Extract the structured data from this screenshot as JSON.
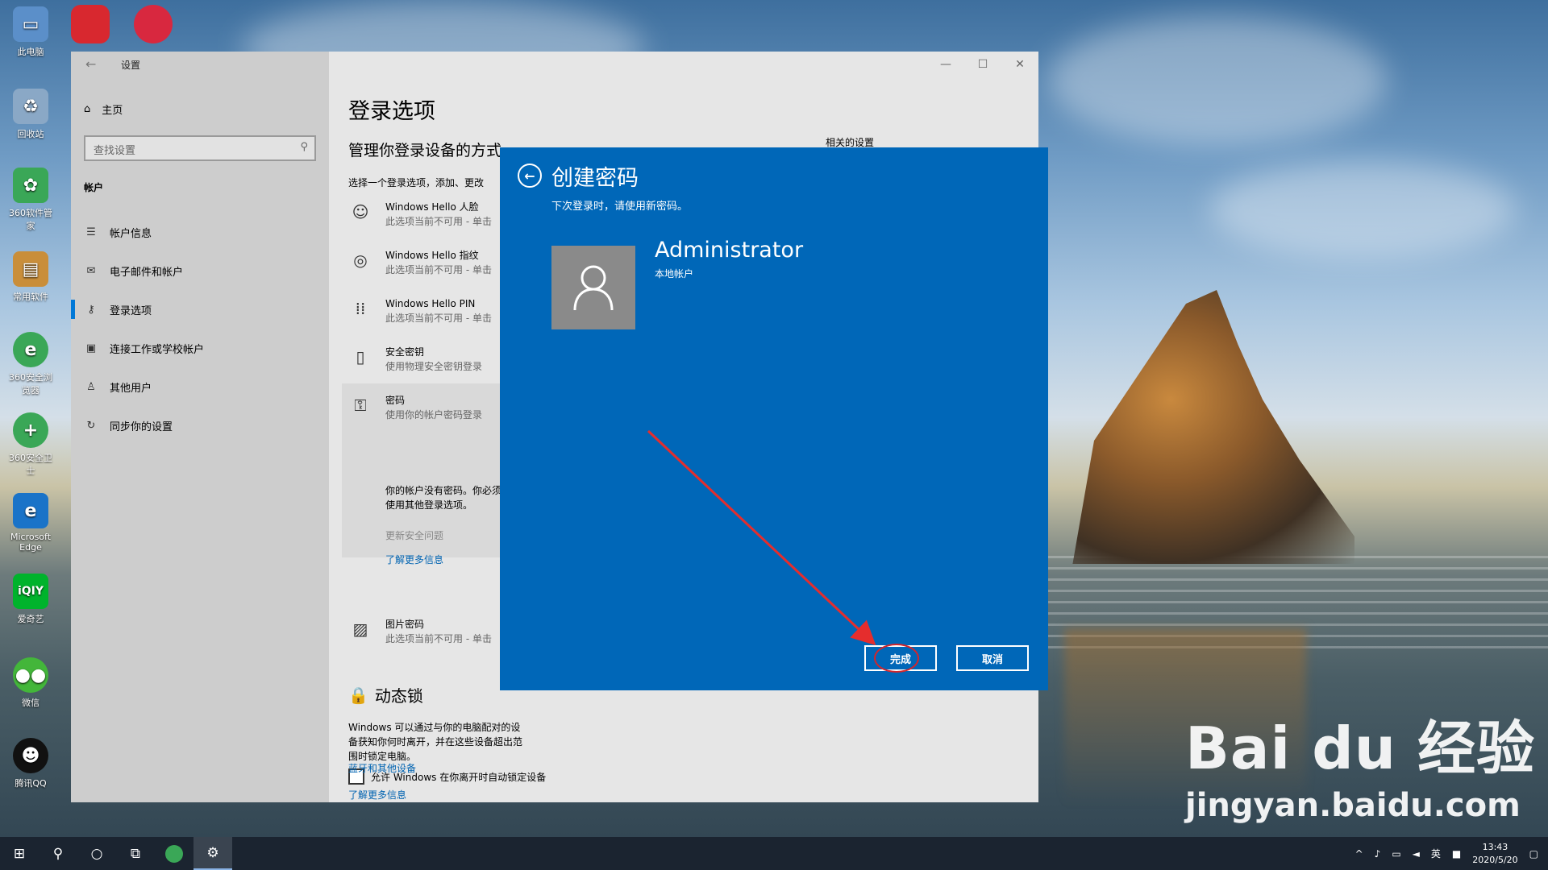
{
  "desktop": {
    "icons": [
      {
        "label": "此电脑",
        "icon": "computer-icon",
        "color": "#5b8fc9"
      },
      {
        "label": "回收站",
        "icon": "recycle-bin-icon",
        "color": "#8aa8c6"
      },
      {
        "label": "360软件管家",
        "icon": "360-manager-icon",
        "color": "#3aa757"
      },
      {
        "label": "常用软件",
        "icon": "folder-icon",
        "color": "#c98e3a"
      },
      {
        "label": "360安全浏览器",
        "icon": "360-browser-icon",
        "color": "#3aa757"
      },
      {
        "label": "360安全卫士",
        "icon": "360-guard-icon",
        "color": "#3aa757"
      },
      {
        "label": "Microsoft Edge",
        "icon": "edge-icon",
        "color": "#1a73c8"
      },
      {
        "label": "爱奇艺",
        "icon": "iqiyi-icon",
        "color": "#00b32c"
      },
      {
        "label": "微信",
        "icon": "wechat-icon",
        "color": "#43b63a"
      },
      {
        "label": "腾讯QQ",
        "icon": "qq-icon",
        "color": "#111111"
      }
    ]
  },
  "window": {
    "title": "设置",
    "sidebar": {
      "home": "主页",
      "search_placeholder": "查找设置",
      "section": "帐户",
      "items": [
        {
          "label": "帐户信息",
          "icon": "person-card-icon"
        },
        {
          "label": "电子邮件和帐户",
          "icon": "mail-icon"
        },
        {
          "label": "登录选项",
          "icon": "key-icon",
          "active": true
        },
        {
          "label": "连接工作或学校帐户",
          "icon": "briefcase-icon"
        },
        {
          "label": "其他用户",
          "icon": "person-add-icon"
        },
        {
          "label": "同步你的设置",
          "icon": "sync-icon"
        }
      ]
    },
    "content": {
      "title": "登录选项",
      "subtitle": "管理你登录设备的方式",
      "desc": "选择一个登录选项，添加、更改",
      "related": "相关的设置",
      "options": [
        {
          "title": "Windows Hello 人脸",
          "sub": "此选项当前不可用 - 单击",
          "icon": "face-icon"
        },
        {
          "title": "Windows Hello 指纹",
          "sub": "此选项当前不可用 - 单击",
          "icon": "fingerprint-icon"
        },
        {
          "title": "Windows Hello PIN",
          "sub": "此选项当前不可用 - 单击",
          "icon": "pin-keypad-icon"
        },
        {
          "title": "安全密钥",
          "sub": "使用物理安全密钥登录",
          "icon": "usb-key-icon"
        },
        {
          "title": "密码",
          "sub": "使用你的帐户密码登录",
          "icon": "password-key-icon"
        }
      ],
      "pw_note": "你的帐户没有密码。你必须添加密码才能使用其他登录选项。",
      "pw_change_q": "更新安全问题",
      "pw_learn": "了解更多信息",
      "picture_pw": {
        "title": "图片密码",
        "sub": "此选项当前不可用 - 单击"
      },
      "dynamic_title": "动态锁",
      "dynamic_desc": "Windows 可以通过与你的电脑配对的设备获知你何时离开，并在这些设备超出范围时锁定电脑。",
      "dynamic_check": "允许 Windows 在你离开时自动锁定设备",
      "link_bt": "蓝牙和其他设备",
      "link_more": "了解更多信息"
    }
  },
  "dialog": {
    "title": "创建密码",
    "subtitle": "下次登录时，请使用新密码。",
    "user_name": "Administrator",
    "user_type": "本地帐户",
    "finish_label": "完成",
    "cancel_label": "取消",
    "bg_color": "#0067b8"
  },
  "taskbar": {
    "time": "13:43",
    "date": "2020/5/20",
    "ime": "英"
  },
  "watermark": {
    "line1": "Bai du 经验",
    "line2": "jingyan.baidu.com"
  }
}
